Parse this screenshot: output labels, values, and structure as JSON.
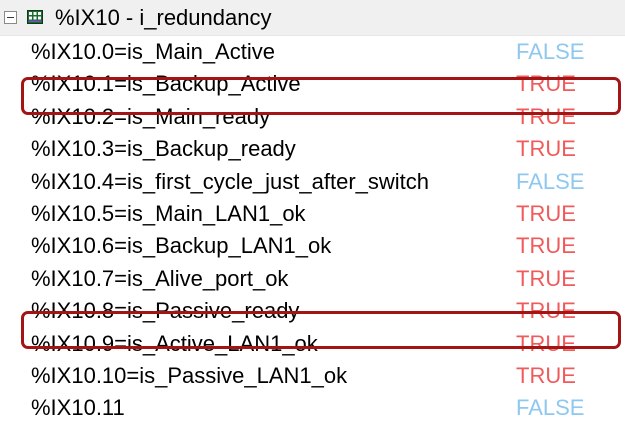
{
  "header": {
    "label": "%IX10 - i_redundancy",
    "icon": "io-module-icon"
  },
  "colors": {
    "true": "#f05a5a",
    "false": "#8ec8f0",
    "highlight": "#a31515"
  },
  "rows": [
    {
      "name": "%IX10.0=is_Main_Active",
      "value": "FALSE"
    },
    {
      "name": "%IX10.1=is_Backup_Active",
      "value": "TRUE",
      "highlighted": true
    },
    {
      "name": "%IX10.2=is_Main_ready",
      "value": "TRUE"
    },
    {
      "name": "%IX10.3=is_Backup_ready",
      "value": "TRUE"
    },
    {
      "name": "%IX10.4=is_first_cycle_just_after_switch",
      "value": "FALSE"
    },
    {
      "name": "%IX10.5=is_Main_LAN1_ok",
      "value": "TRUE"
    },
    {
      "name": "%IX10.6=is_Backup_LAN1_ok",
      "value": "TRUE"
    },
    {
      "name": "%IX10.7=is_Alive_port_ok",
      "value": "TRUE"
    },
    {
      "name": "%IX10.8=is_Passive_ready",
      "value": "TRUE",
      "highlighted": true
    },
    {
      "name": "%IX10.9=is_Active_LAN1_ok",
      "value": "TRUE"
    },
    {
      "name": "%IX10.10=is_Passive_LAN1_ok",
      "value": "TRUE"
    },
    {
      "name": "%IX10.11",
      "value": "FALSE"
    }
  ]
}
